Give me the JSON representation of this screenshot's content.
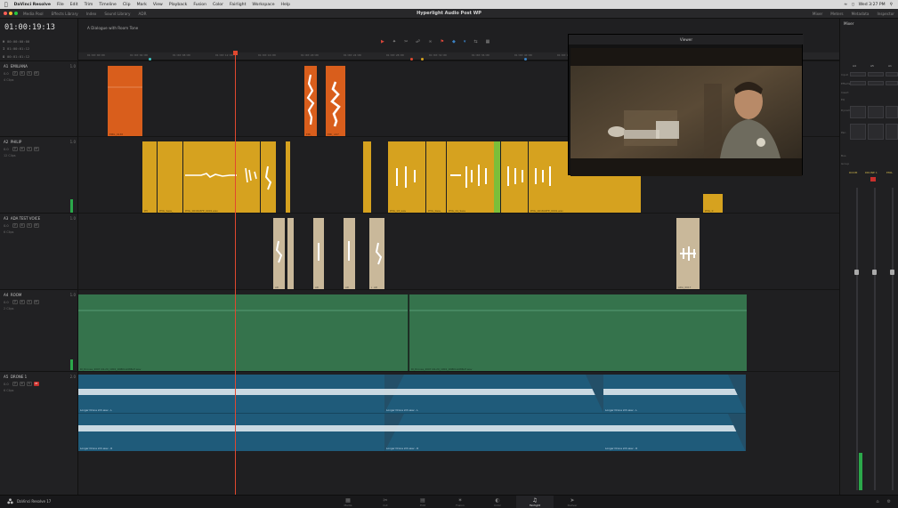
{
  "menubar": {
    "app": "DaVinci Resolve",
    "items": [
      "File",
      "Edit",
      "Trim",
      "Timeline",
      "Clip",
      "Mark",
      "View",
      "Playback",
      "Fusion",
      "Color",
      "Fairlight",
      "Workspace",
      "Help"
    ],
    "clock": "Wed 3:27 PM"
  },
  "toolbar": {
    "buttons": [
      "Media Pool",
      "Effects Library",
      "Index",
      "Sound Library",
      "ADR"
    ],
    "project_title": "Hyperlight Audio Post WP",
    "right_buttons": [
      "Mixer",
      "Meters",
      "Metadata",
      "Inspector"
    ]
  },
  "timeline": {
    "name": "A Dialogue with Room Tone",
    "timecode": "01:00:19:13",
    "sub_timecodes": [
      {
        "mark": "H",
        "value": "00:00:00:00"
      },
      {
        "mark": "I",
        "value": "01:00:01:12"
      },
      {
        "mark": "O",
        "value": "00:01:01:12"
      }
    ],
    "ruler_ticks": [
      "01:00:00:00",
      "01:00:04:00",
      "01:00:08:00",
      "01:00:12:00",
      "01:00:16:00",
      "01:00:20:00",
      "01:00:24:00",
      "01:00:28:00",
      "01:00:32:00",
      "01:00:36:00",
      "01:00:40:00",
      "01:00:44:00"
    ]
  },
  "tracks": [
    {
      "id": "A1",
      "name": "EMILIANA",
      "vol": "0.0",
      "num": "1.0",
      "clips_label": "4 Clips",
      "red": false
    },
    {
      "id": "A2",
      "name": "PHILIP",
      "vol": "0.0",
      "num": "1.0",
      "clips_label": "12 Clips",
      "red": false
    },
    {
      "id": "A3",
      "name": "ADA TEST VOICE",
      "vol": "0.0",
      "num": "1.0",
      "clips_label": "6 Clips",
      "red": false
    },
    {
      "id": "A4",
      "name": "ROOM",
      "vol": "0.0",
      "num": "1.0",
      "clips_label": "2 Clips",
      "red": false
    },
    {
      "id": "A5",
      "name": "DRONE 1",
      "vol": "0.0",
      "num": "2.0",
      "clips_label": "6 Clips",
      "red": true
    }
  ],
  "clip_labels": {
    "emiliana": [
      "EMIL_0138",
      "EMI_",
      "EMI_ A07"
    ],
    "philip": [
      "PH",
      "PHIL_Sess_",
      "PHIL_0018A5FE_0001.wav",
      "PHIL_03_wav",
      "PHIL_0ess_",
      "PHIL_01_Sess",
      "PHIL_0018A5FE_0001.wav",
      "PHIL_0"
    ],
    "ada": [
      "AD",
      "AD",
      "AD",
      "AD",
      "AD",
      "ADA_0017"
    ],
    "room": [
      "RI_Drones_2007-04-20_1902_1N8DLG986LE.wav",
      "RI_Drones_2007-04-20_1902_1N8DLG986LE.wav"
    ],
    "drone_l": [
      "Longer Drone 2ch.wav - L",
      "Longer Drone 2ch.wav - L",
      "Longer Drone 2ch.wav - L"
    ],
    "drone_r": [
      "Longer Drone 2ch.wav - R",
      "Longer Drone 2ch.wav - R",
      "Longer Drone 2ch.wav - R"
    ]
  },
  "viewer": {
    "title": "Viewer"
  },
  "mixer": {
    "title": "Mixer",
    "channels": [
      "A4",
      "A5",
      "A1"
    ],
    "row_labels": [
      "Input",
      "Effects",
      "Insert",
      "EQ",
      "Dynamics",
      "Pan",
      "Bus",
      "Group"
    ],
    "strip_names": [
      "ROOM",
      "DRONE 1",
      "EMIL"
    ]
  },
  "pages": [
    {
      "label": "Media",
      "icon": "▦"
    },
    {
      "label": "Cut",
      "icon": "✂"
    },
    {
      "label": "Edit",
      "icon": "▤"
    },
    {
      "label": "Fusion",
      "icon": "✶"
    },
    {
      "label": "Color",
      "icon": "◐"
    },
    {
      "label": "Fairlight",
      "icon": "♫"
    },
    {
      "label": "Deliver",
      "icon": "➤"
    }
  ],
  "app_name": "DaVinci Resolve 17",
  "colors": {
    "emiliana_clip": "#d95e1c",
    "philip_clip": "#d6a21f",
    "ada_clip": "#c9b89a",
    "room_clip": "#35734c",
    "drone_clip": "#1f5b7a",
    "playhead": "#e0482f",
    "meter": "#2ba84a"
  }
}
